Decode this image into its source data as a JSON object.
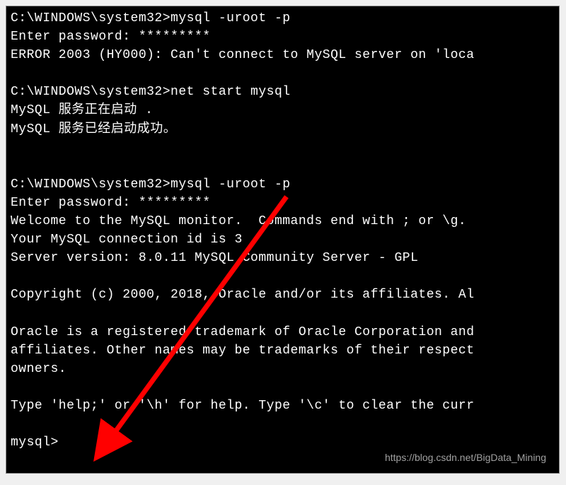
{
  "terminal": {
    "lines": [
      "C:\\WINDOWS\\system32>mysql -uroot -p",
      "Enter password: *********",
      "ERROR 2003 (HY000): Can't connect to MySQL server on 'loca",
      "",
      "C:\\WINDOWS\\system32>net start mysql",
      "MySQL 服务正在启动 .",
      "MySQL 服务已经启动成功。",
      "",
      "",
      "C:\\WINDOWS\\system32>mysql -uroot -p",
      "Enter password: *********",
      "Welcome to the MySQL monitor.  Commands end with ; or \\g.",
      "Your MySQL connection id is 3",
      "Server version: 8.0.11 MySQL Community Server - GPL",
      "",
      "Copyright (c) 2000, 2018, Oracle and/or its affiliates. Al",
      "",
      "Oracle is a registered trademark of Oracle Corporation and",
      "affiliates. Other names may be trademarks of their respect",
      "owners.",
      "",
      "Type 'help;' or '\\h' for help. Type '\\c' to clear the curr",
      "",
      "mysql>"
    ]
  },
  "watermark": "https://blog.csdn.net/BigData_Mining",
  "arrow": {
    "color": "#ff0000"
  }
}
